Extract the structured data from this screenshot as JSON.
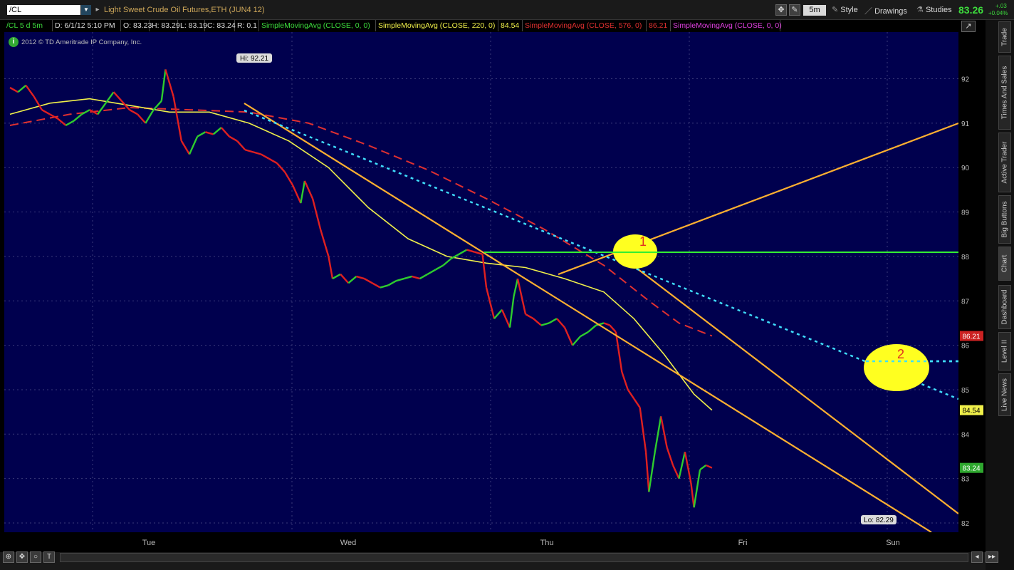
{
  "topbar": {
    "symbol": "/CL",
    "description": "Light Sweet Crude Oil Futures,ETH (JUN4 12)",
    "timeframe": "5m",
    "style_label": "Style",
    "drawings_label": "Drawings",
    "studies_label": "Studies",
    "last_price": "83.26",
    "net_change": "+.03",
    "percent_change": "+0.04%"
  },
  "infobar": {
    "cells": [
      {
        "text": "/CL 5 d 5m",
        "color": "#3ddc3d"
      },
      {
        "text": "D: 6/1/12 5:10 PM",
        "color": "#dddddd"
      },
      {
        "text": "O: 83.23",
        "color": "#dddddd"
      },
      {
        "text": "H: 83.29",
        "color": "#dddddd"
      },
      {
        "text": "L: 83.19",
        "color": "#dddddd"
      },
      {
        "text": "C: 83.24",
        "color": "#dddddd"
      },
      {
        "text": "R: 0.1",
        "color": "#dddddd"
      },
      {
        "text": "SimpleMovingAvg (CLOSE, 0, 0)",
        "color": "#3ddc3d"
      },
      {
        "text": "SimpleMovingAvg (CLOSE, 220, 0)",
        "color": "#f0f04a"
      },
      {
        "text": "84.54",
        "color": "#f0f04a"
      },
      {
        "text": "SimpleMovingAvg (CLOSE, 576, 0)",
        "color": "#e03030"
      },
      {
        "text": "86.21",
        "color": "#e03030"
      },
      {
        "text": "SimpleMovingAvg (CLOSE, 0, 0)",
        "color": "#e040e0"
      }
    ]
  },
  "copyright": "2012 © TD Ameritrade IP Company, Inc.",
  "right_tabs": [
    "Trade",
    "Times And Sales",
    "Active Trader",
    "Big Buttons",
    "Chart",
    "Dashboard",
    "Level II",
    "Live News"
  ],
  "chart_data": {
    "type": "line",
    "title": "",
    "xlabel": "",
    "ylabel": "",
    "x_ticks": [
      "Tue",
      "Wed",
      "Thu",
      "Fri",
      "Sun"
    ],
    "ylim": [
      82,
      92
    ],
    "y_ticks": [
      82,
      83,
      84,
      85,
      86,
      87,
      88,
      89,
      90,
      91,
      92
    ],
    "grid": true,
    "price_series": [
      [
        0.0,
        91.8
      ],
      [
        0.04,
        91.7
      ],
      [
        0.08,
        91.85
      ],
      [
        0.12,
        91.6
      ],
      [
        0.16,
        91.3
      ],
      [
        0.2,
        91.2
      ],
      [
        0.24,
        91.1
      ],
      [
        0.28,
        90.95
      ],
      [
        0.32,
        91.05
      ],
      [
        0.36,
        91.2
      ],
      [
        0.4,
        91.3
      ],
      [
        0.44,
        91.2
      ],
      [
        0.48,
        91.45
      ],
      [
        0.52,
        91.7
      ],
      [
        0.56,
        91.5
      ],
      [
        0.6,
        91.3
      ],
      [
        0.64,
        91.2
      ],
      [
        0.68,
        91.0
      ],
      [
        0.72,
        91.3
      ],
      [
        0.76,
        91.5
      ],
      [
        0.78,
        92.21
      ],
      [
        0.82,
        91.6
      ],
      [
        0.86,
        90.6
      ],
      [
        0.9,
        90.3
      ],
      [
        0.94,
        90.7
      ],
      [
        0.98,
        90.8
      ],
      [
        1.02,
        90.75
      ],
      [
        1.06,
        90.9
      ],
      [
        1.1,
        90.7
      ],
      [
        1.14,
        90.6
      ],
      [
        1.18,
        90.4
      ],
      [
        1.22,
        90.35
      ],
      [
        1.26,
        90.3
      ],
      [
        1.3,
        90.2
      ],
      [
        1.34,
        90.1
      ],
      [
        1.38,
        89.9
      ],
      [
        1.42,
        89.6
      ],
      [
        1.46,
        89.2
      ],
      [
        1.48,
        89.7
      ],
      [
        1.52,
        89.3
      ],
      [
        1.56,
        88.6
      ],
      [
        1.6,
        88.0
      ],
      [
        1.62,
        87.5
      ],
      [
        1.66,
        87.6
      ],
      [
        1.7,
        87.4
      ],
      [
        1.74,
        87.55
      ],
      [
        1.78,
        87.5
      ],
      [
        1.82,
        87.4
      ],
      [
        1.86,
        87.3
      ],
      [
        1.9,
        87.35
      ],
      [
        1.94,
        87.45
      ],
      [
        1.98,
        87.5
      ],
      [
        2.02,
        87.55
      ],
      [
        2.06,
        87.5
      ],
      [
        2.1,
        87.6
      ],
      [
        2.14,
        87.7
      ],
      [
        2.18,
        87.8
      ],
      [
        2.22,
        87.95
      ],
      [
        2.26,
        88.05
      ],
      [
        2.3,
        88.15
      ],
      [
        2.34,
        88.1
      ],
      [
        2.38,
        88.05
      ],
      [
        2.4,
        87.3
      ],
      [
        2.44,
        86.6
      ],
      [
        2.48,
        86.8
      ],
      [
        2.52,
        86.4
      ],
      [
        2.54,
        87.1
      ],
      [
        2.56,
        87.5
      ],
      [
        2.6,
        86.7
      ],
      [
        2.64,
        86.6
      ],
      [
        2.68,
        86.45
      ],
      [
        2.72,
        86.5
      ],
      [
        2.76,
        86.6
      ],
      [
        2.8,
        86.4
      ],
      [
        2.84,
        86.0
      ],
      [
        2.88,
        86.2
      ],
      [
        2.92,
        86.3
      ],
      [
        2.96,
        86.45
      ],
      [
        3.0,
        86.5
      ],
      [
        3.04,
        86.45
      ],
      [
        3.08,
        86.3
      ],
      [
        3.12,
        85.4
      ],
      [
        3.16,
        85.0
      ],
      [
        3.2,
        84.8
      ],
      [
        3.24,
        84.6
      ],
      [
        3.28,
        83.6
      ],
      [
        3.3,
        82.7
      ],
      [
        3.34,
        83.6
      ],
      [
        3.38,
        84.4
      ],
      [
        3.42,
        83.7
      ],
      [
        3.46,
        83.3
      ],
      [
        3.5,
        83.0
      ],
      [
        3.54,
        83.6
      ],
      [
        3.58,
        82.9
      ],
      [
        3.6,
        82.35
      ],
      [
        3.64,
        83.2
      ],
      [
        3.68,
        83.3
      ],
      [
        3.72,
        83.24
      ]
    ],
    "series": [
      {
        "name": "SimpleMovingAvg (CLOSE, 220, 0)",
        "color": "#f0f04a",
        "values": [
          [
            0.0,
            91.2
          ],
          [
            0.2,
            91.45
          ],
          [
            0.4,
            91.55
          ],
          [
            0.6,
            91.4
          ],
          [
            0.8,
            91.25
          ],
          [
            1.0,
            91.25
          ],
          [
            1.2,
            91.0
          ],
          [
            1.4,
            90.6
          ],
          [
            1.6,
            90.0
          ],
          [
            1.8,
            89.1
          ],
          [
            2.0,
            88.4
          ],
          [
            2.2,
            88.0
          ],
          [
            2.4,
            87.85
          ],
          [
            2.6,
            87.75
          ],
          [
            2.8,
            87.5
          ],
          [
            3.0,
            87.2
          ],
          [
            3.2,
            86.6
          ],
          [
            3.4,
            85.8
          ],
          [
            3.6,
            84.9
          ],
          [
            3.72,
            84.54
          ]
        ]
      },
      {
        "name": "SimpleMovingAvg (CLOSE, 576, 0)",
        "color": "#e03030",
        "values": [
          [
            0.0,
            90.95
          ],
          [
            0.3,
            91.2
          ],
          [
            0.6,
            91.35
          ],
          [
            0.9,
            91.3
          ],
          [
            1.2,
            91.25
          ],
          [
            1.5,
            91.0
          ],
          [
            1.8,
            90.5
          ],
          [
            2.1,
            89.95
          ],
          [
            2.4,
            89.3
          ],
          [
            2.7,
            88.6
          ],
          [
            3.0,
            87.8
          ],
          [
            3.3,
            87.0
          ],
          [
            3.5,
            86.5
          ],
          [
            3.72,
            86.21
          ]
        ]
      }
    ],
    "annotations": [
      {
        "text": "Hi: 92.21",
        "x": 0.78,
        "y": 92.21
      },
      {
        "text": "Lo: 82.29",
        "x": 3.6,
        "y": 82.29
      },
      {
        "text": "1",
        "x": 2.52,
        "y": 88.2
      },
      {
        "text": "2",
        "x": 3.76,
        "y": 85.7
      }
    ],
    "price_labels": [
      {
        "text": "86.21",
        "value": 86.21,
        "bg": "#cc2222",
        "fg": "#ffffff"
      },
      {
        "text": "84.54",
        "value": 84.54,
        "bg": "#f0f04a",
        "fg": "#000000"
      },
      {
        "text": "83.24",
        "value": 83.24,
        "bg": "#2fa82f",
        "fg": "#ffffff"
      }
    ],
    "colors": {
      "background": "#00004e",
      "up": "#2ecc2e",
      "down": "#e02020",
      "trendline": "#ffb030",
      "horizontal": "#33ee33",
      "dotted": "#40e0ff",
      "highlight": "#ffff20"
    }
  }
}
